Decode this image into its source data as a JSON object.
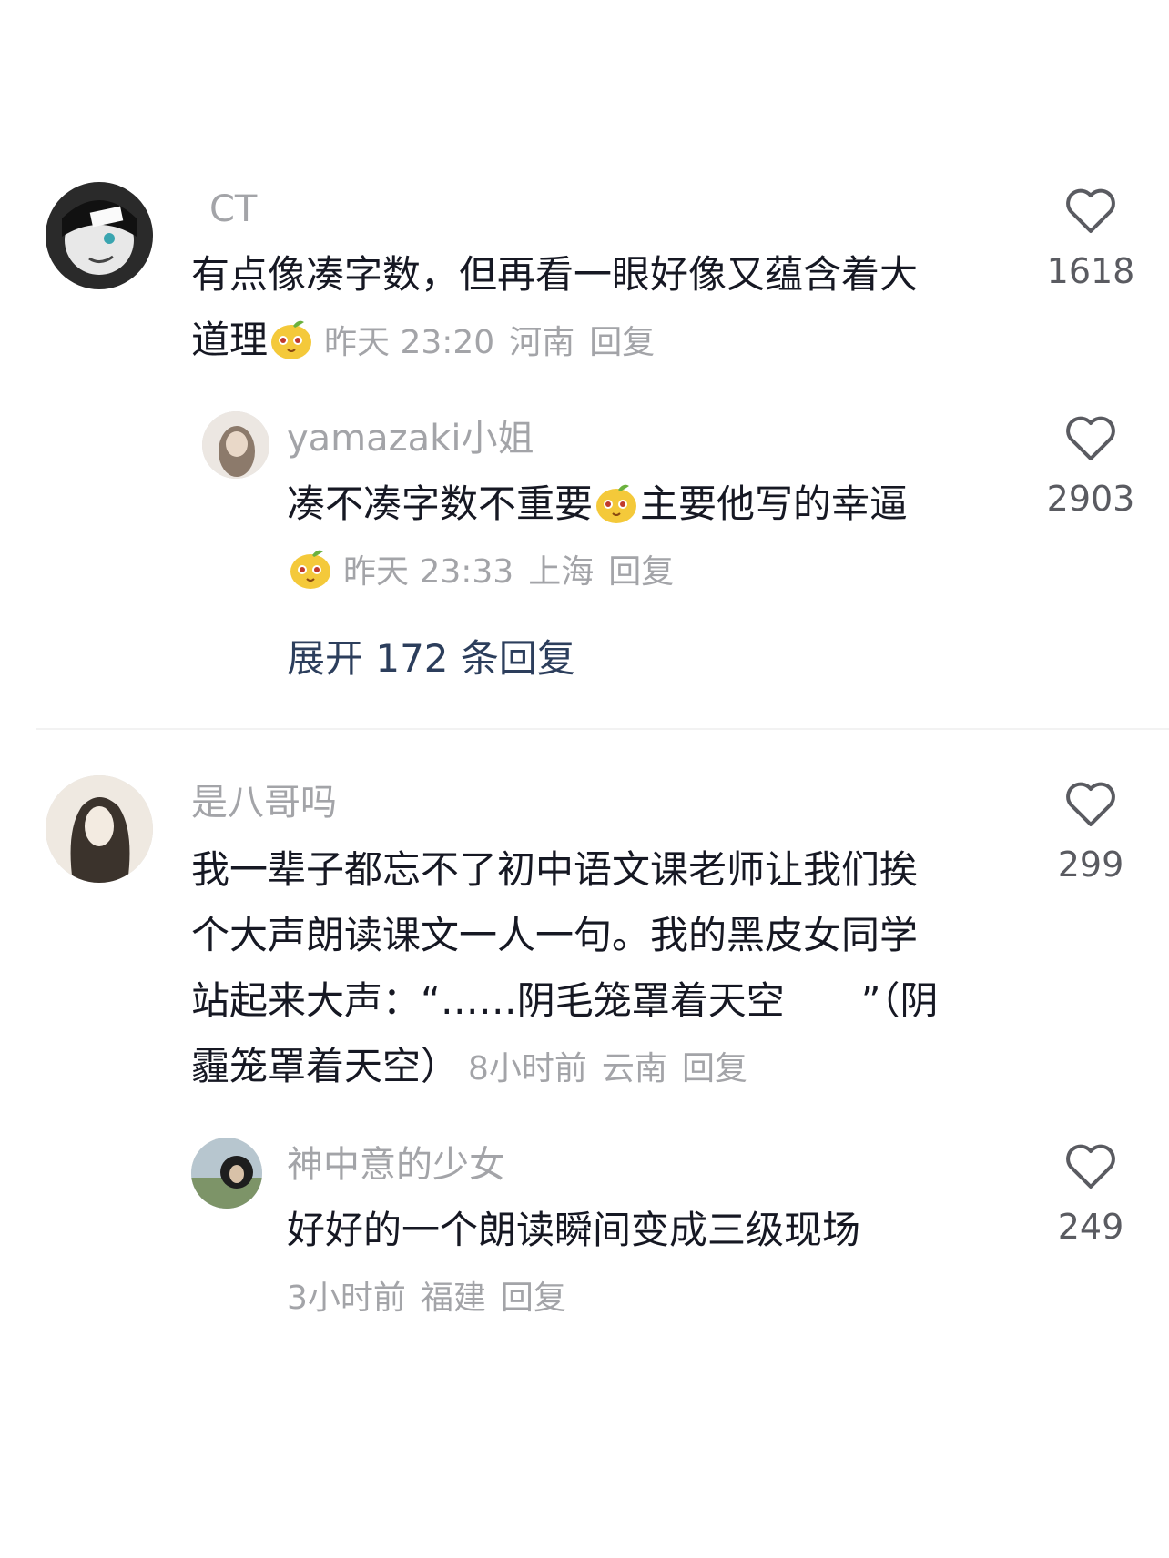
{
  "comments": [
    {
      "username": "CT",
      "text_line1": "有点像凑字数，但再看一眼好像又蕴含着大",
      "text_line2": "道理",
      "emoji": "pear-emoji",
      "time": "昨天 23:20",
      "location": "河南",
      "reply_label": "回复",
      "likes": "1618"
    },
    {
      "username": "yamazaki小姐",
      "text_part1": "凑不凑字数不重要",
      "emoji": "pear-emoji",
      "text_part2": "主要他写的幸逼",
      "time": "昨天 23:33",
      "location": "上海",
      "reply_label": "回复",
      "likes": "2903"
    },
    {
      "username": "是八哥吗",
      "text_line1": "我一辈子都忘不了初中语文课老师让我们挨",
      "text_line2": "个大声朗读课文一人一句。我的黑皮女同学",
      "text_line3": "站起来大声：“……阴毛笼罩着天空　　”（阴",
      "text_line4": "霾笼罩着天空）",
      "time": "8小时前",
      "location": "云南",
      "reply_label": "回复",
      "likes": "299"
    },
    {
      "username": "神中意的少女",
      "text_line1": "好好的一个朗读瞬间变成三级现场",
      "time": "3小时前",
      "location": "福建",
      "reply_label": "回复",
      "likes": "249"
    }
  ],
  "expand_replies": "展开 172 条回复",
  "icons": {
    "like": "heart-outline-icon",
    "emoji": "pear-emoji"
  },
  "colors": {
    "username": "#a3a4a8",
    "text": "#161823",
    "meta": "#a3a4a8",
    "expand": "#2c3e5c"
  }
}
